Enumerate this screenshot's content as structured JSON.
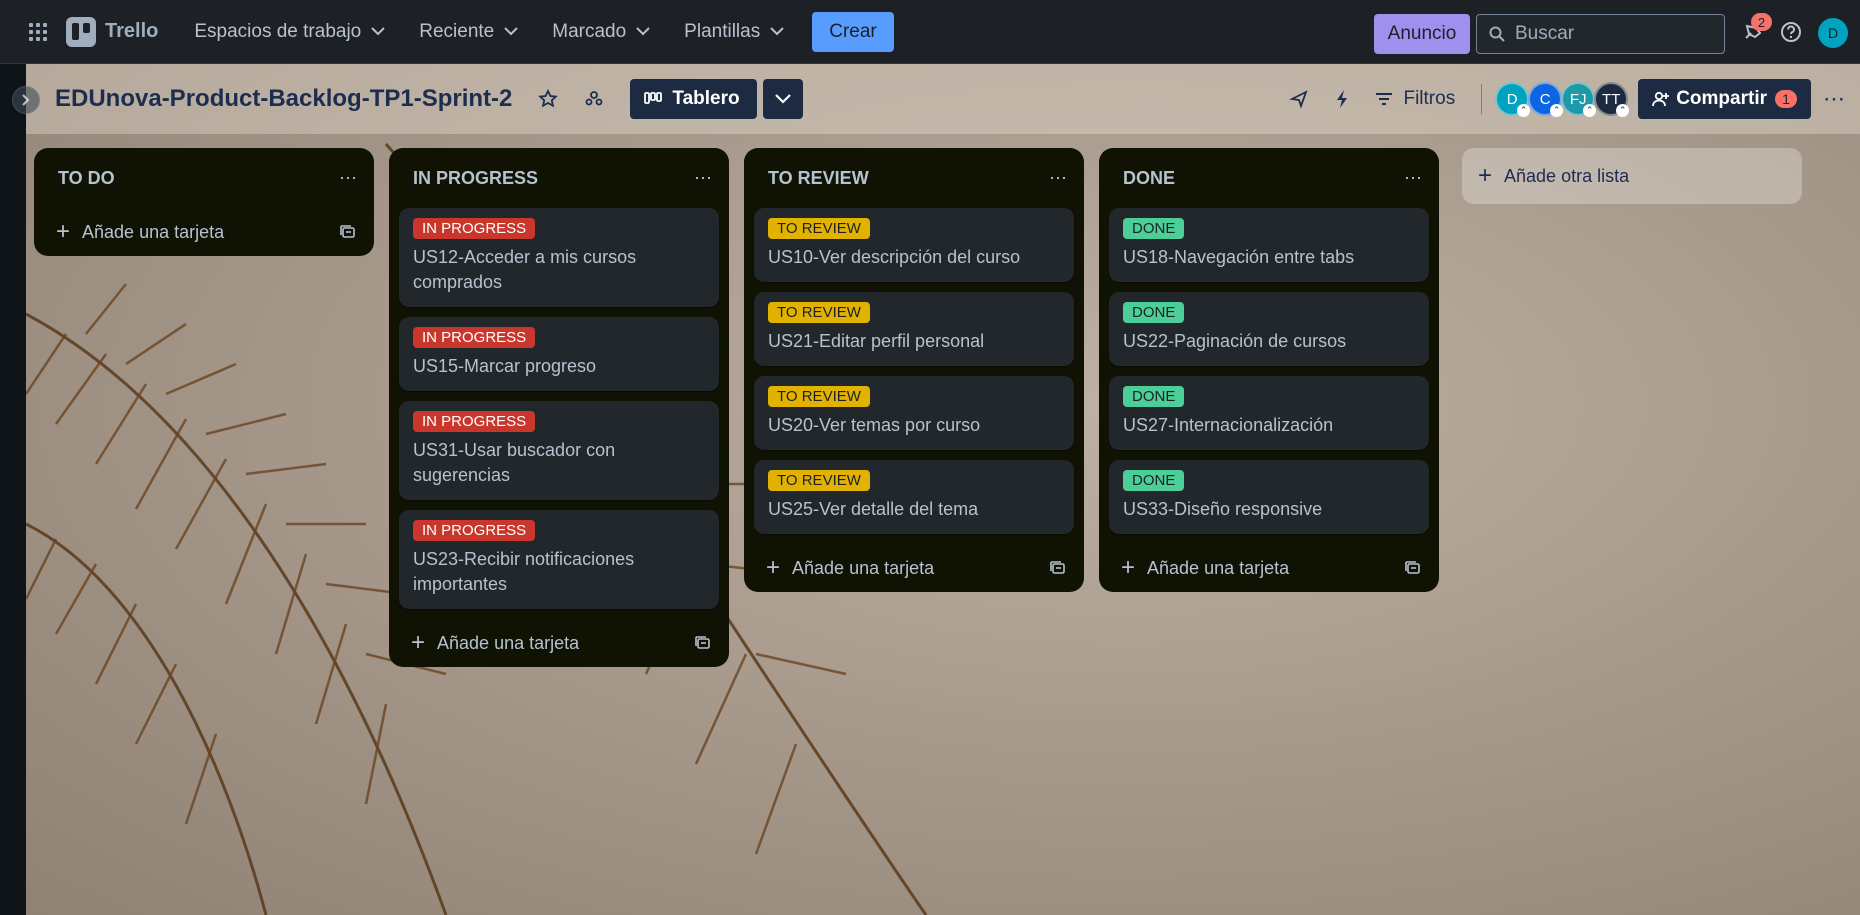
{
  "topnav": {
    "app_name": "Trello",
    "menu": [
      {
        "label": "Espacios de trabajo"
      },
      {
        "label": "Reciente"
      },
      {
        "label": "Marcado"
      },
      {
        "label": "Plantillas"
      }
    ],
    "create_label": "Crear",
    "promo_label": "Anuncio",
    "search_placeholder": "Buscar",
    "notifications_count": "2",
    "user_initial": "D"
  },
  "board": {
    "title": "EDUnova-Product-Backlog-TP1-Sprint-2",
    "view_label": "Tablero",
    "filters_label": "Filtros",
    "members": [
      {
        "initials": "D",
        "color": "#00a3bf"
      },
      {
        "initials": "C",
        "color": "#0c66e4"
      },
      {
        "initials": "FJ",
        "color": "#1d9aaa"
      },
      {
        "initials": "TT",
        "color": "#1c2b41"
      }
    ],
    "share_label": "Compartir",
    "share_count": "1",
    "add_list_label": "Añade otra lista",
    "add_card_label": "Añade una tarjeta"
  },
  "lists": [
    {
      "title": "TO DO",
      "cards": []
    },
    {
      "title": "IN PROGRESS",
      "cards": [
        {
          "label": "IN PROGRESS",
          "title": "US12-Acceder a mis cursos comprados"
        },
        {
          "label": "IN PROGRESS",
          "title": "US15-Marcar progreso"
        },
        {
          "label": "IN PROGRESS",
          "title": "US31-Usar buscador con sugerencias"
        },
        {
          "label": "IN PROGRESS",
          "title": "US23-Recibir notificaciones importantes"
        }
      ]
    },
    {
      "title": "TO REVIEW",
      "cards": [
        {
          "label": "TO REVIEW",
          "title": "US10-Ver descripción del curso"
        },
        {
          "label": "TO REVIEW",
          "title": "US21-Editar perfil personal"
        },
        {
          "label": "TO REVIEW",
          "title": "US20-Ver temas por curso"
        },
        {
          "label": "TO REVIEW",
          "title": "US25-Ver detalle del tema"
        }
      ]
    },
    {
      "title": "DONE",
      "cards": [
        {
          "label": "DONE",
          "title": "US18-Navegación entre tabs"
        },
        {
          "label": "DONE",
          "title": "US22-Paginación de cursos"
        },
        {
          "label": "DONE",
          "title": "US27-Internacionalización"
        },
        {
          "label": "DONE",
          "title": "US33-Diseño responsive"
        }
      ]
    }
  ],
  "colors": {
    "label_in_progress": "#c9372c",
    "label_to_review": "#e2b203",
    "label_done": "#4bce97",
    "create_button": "#579dff",
    "promo_button": "#9f8fef"
  }
}
